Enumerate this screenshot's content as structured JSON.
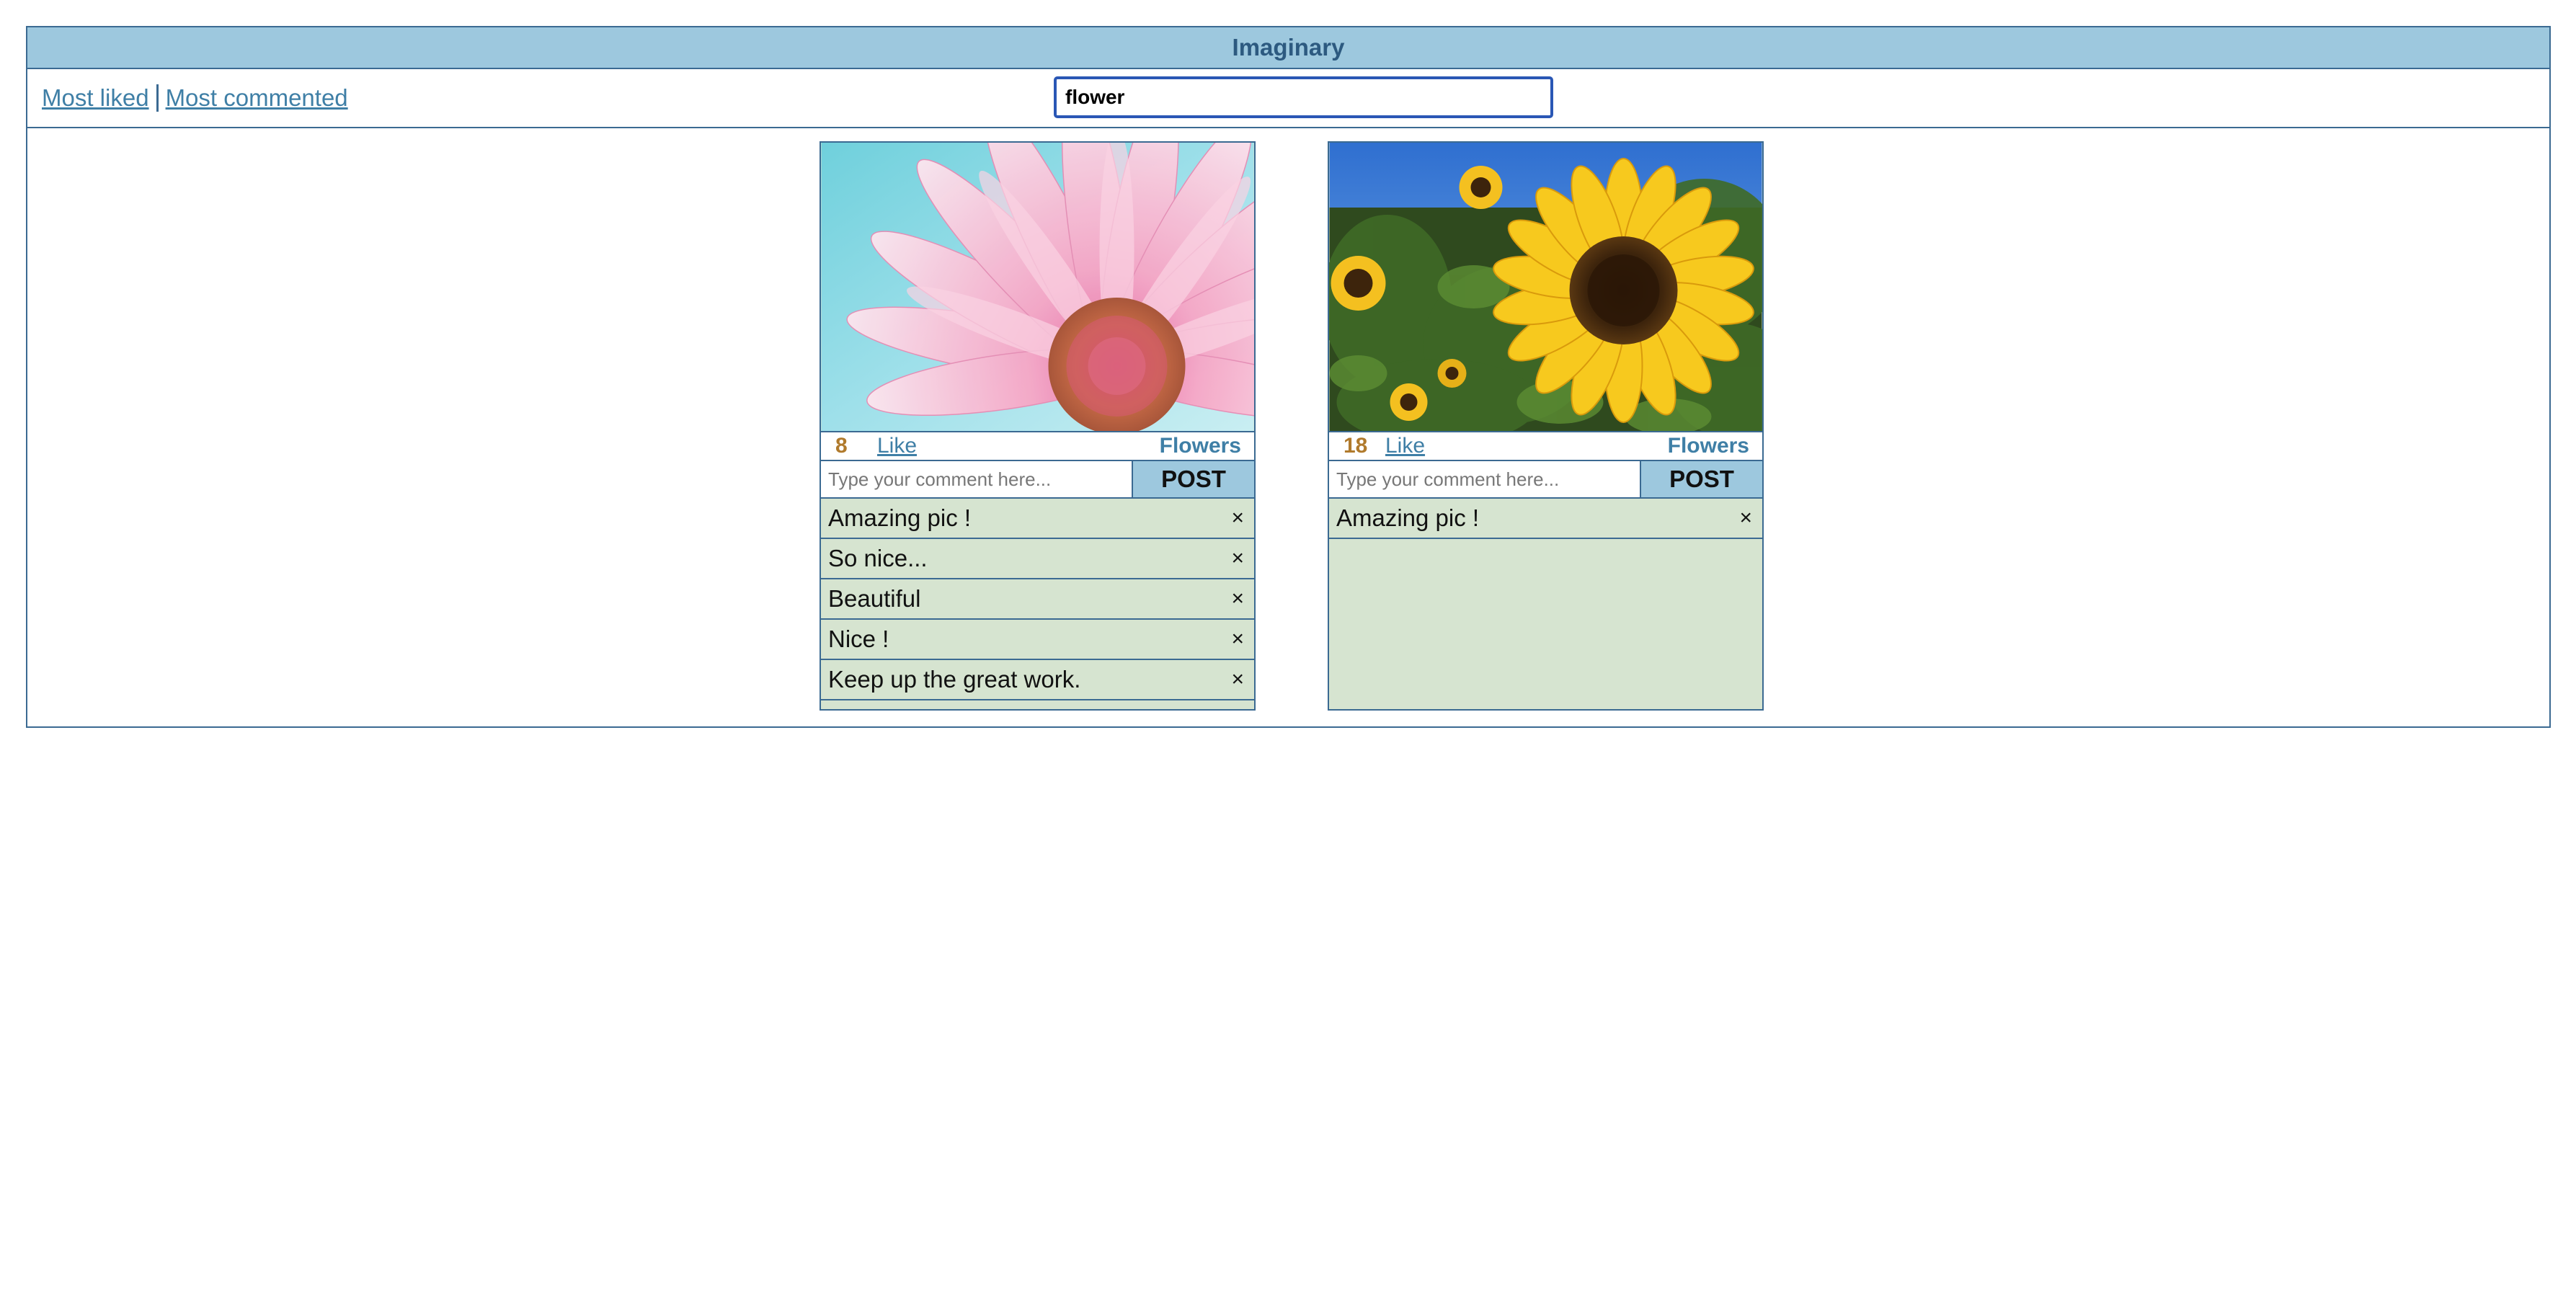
{
  "app": {
    "title": "Imaginary"
  },
  "nav": {
    "most_liked": "Most liked",
    "most_commented": "Most commented"
  },
  "search": {
    "value": "flower"
  },
  "posts": [
    {
      "likes": "8",
      "like_label": "Like",
      "category": "Flowers",
      "comment_placeholder": "Type your comment here...",
      "post_label": "POST",
      "image": "pink-daisy-closeup",
      "comments": [
        "Amazing pic !",
        "So nice...",
        "Beautiful",
        "Nice !",
        "Keep up the great work."
      ]
    },
    {
      "likes": "18",
      "like_label": "Like",
      "category": "Flowers",
      "comment_placeholder": "Type your comment here...",
      "post_label": "POST",
      "image": "sunflower-field",
      "comments": [
        "Amazing pic !"
      ]
    }
  ],
  "delete_symbol": "×",
  "colors": {
    "header_bg": "#9dc8de",
    "border": "#3b6a92",
    "link": "#3f7fa6",
    "likes": "#b07a2c",
    "comments_bg": "#d6e4d0"
  }
}
